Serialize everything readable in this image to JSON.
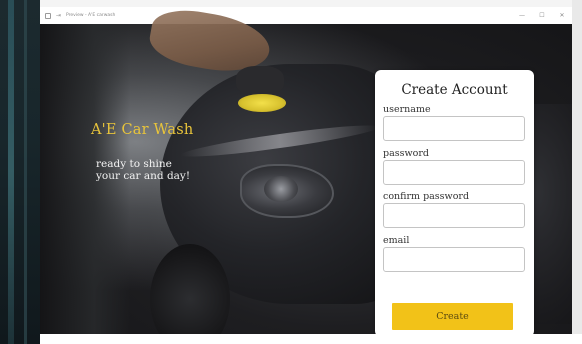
{
  "window": {
    "title": "Preview - A'E carwash",
    "minimize_glyph": "—",
    "maximize_glyph": "☐",
    "close_glyph": "✕"
  },
  "hero": {
    "brand": "A'E Car Wash",
    "tagline_line1": "ready to shine",
    "tagline_line2": "your car and day!"
  },
  "form": {
    "title": "Create Account",
    "fields": [
      {
        "label": "username",
        "value": "",
        "placeholder": ""
      },
      {
        "label": "password",
        "value": "",
        "placeholder": ""
      },
      {
        "label": "confirm password",
        "value": "",
        "placeholder": ""
      },
      {
        "label": "email",
        "value": "",
        "placeholder": ""
      }
    ],
    "submit_label": "Create"
  },
  "colors": {
    "brand_text": "#e8c43b",
    "button_bg": "#f2c218",
    "card_bg": "#ffffff"
  },
  "icons": {
    "titlebar_app": "app-icon",
    "titlebar_back": "arrow-icon"
  }
}
